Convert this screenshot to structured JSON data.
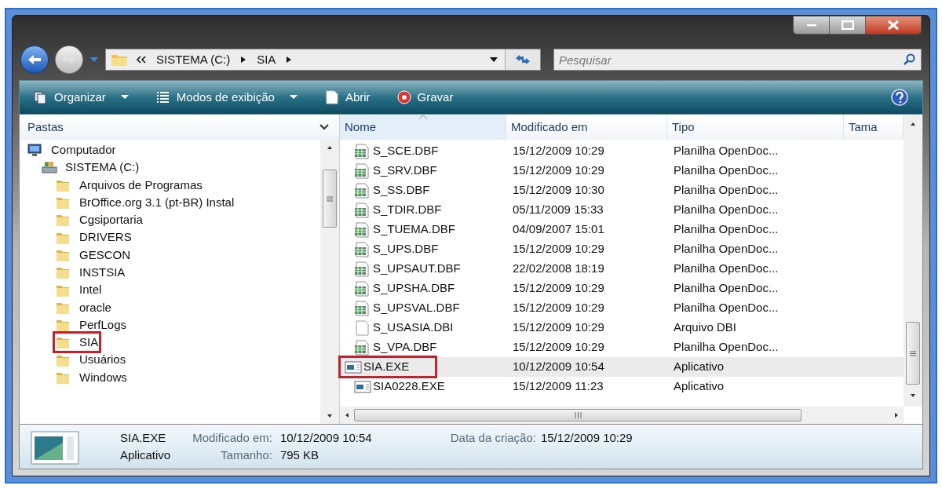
{
  "address": {
    "segments": [
      "SISTEMA (C:)",
      "SIA"
    ]
  },
  "search": {
    "placeholder": "Pesquisar"
  },
  "toolbar": [
    {
      "label": "Organizar",
      "kind": "organize",
      "dropdown": true
    },
    {
      "label": "Modos de exibição",
      "kind": "views",
      "dropdown": true
    },
    {
      "label": "Abrir",
      "kind": "open",
      "dropdown": false
    },
    {
      "label": "Gravar",
      "kind": "burn",
      "dropdown": false
    }
  ],
  "folders_pane": {
    "title": "Pastas",
    "tree": [
      {
        "label": "Computador",
        "kind": "computer",
        "highlighted": false,
        "children": [
          {
            "label": "SISTEMA (C:)",
            "kind": "drive",
            "highlighted": false,
            "children": [
              {
                "label": "Arquivos de Programas",
                "kind": "folder",
                "highlighted": false
              },
              {
                "label": "BrOffice.org 3.1 (pt-BR) Instal",
                "kind": "folder",
                "highlighted": false
              },
              {
                "label": "Cgsiportaria",
                "kind": "folder",
                "highlighted": false
              },
              {
                "label": "DRIVERS",
                "kind": "folder",
                "highlighted": false
              },
              {
                "label": "GESCON",
                "kind": "folder",
                "highlighted": false
              },
              {
                "label": "INSTSIA",
                "kind": "folder",
                "highlighted": false
              },
              {
                "label": "Intel",
                "kind": "folder",
                "highlighted": false
              },
              {
                "label": "oracle",
                "kind": "folder",
                "highlighted": false
              },
              {
                "label": "PerfLogs",
                "kind": "folder",
                "highlighted": false
              },
              {
                "label": "SIA",
                "kind": "folder",
                "highlighted": true
              },
              {
                "label": "Usuários",
                "kind": "folder",
                "highlighted": false
              },
              {
                "label": "Windows",
                "kind": "folder",
                "highlighted": false
              }
            ]
          }
        ]
      }
    ]
  },
  "file_list": {
    "columns": [
      "Nome",
      "Modificado em",
      "Tipo",
      "Tama"
    ],
    "rows": [
      {
        "name": "S_SCE.DBF",
        "modified": "15/12/2009 10:29",
        "type": "Planilha OpenDoc...",
        "kind": "spreadsheet",
        "selected": false,
        "highlighted": false
      },
      {
        "name": "S_SRV.DBF",
        "modified": "15/12/2009 10:29",
        "type": "Planilha OpenDoc...",
        "kind": "spreadsheet",
        "selected": false,
        "highlighted": false
      },
      {
        "name": "S_SS.DBF",
        "modified": "15/12/2009 10:30",
        "type": "Planilha OpenDoc...",
        "kind": "spreadsheet",
        "selected": false,
        "highlighted": false
      },
      {
        "name": "S_TDIR.DBF",
        "modified": "05/11/2009 15:33",
        "type": "Planilha OpenDoc...",
        "kind": "spreadsheet",
        "selected": false,
        "highlighted": false
      },
      {
        "name": "S_TUEMA.DBF",
        "modified": "04/09/2007 15:01",
        "type": "Planilha OpenDoc...",
        "kind": "spreadsheet",
        "selected": false,
        "highlighted": false
      },
      {
        "name": "S_UPS.DBF",
        "modified": "15/12/2009 10:29",
        "type": "Planilha OpenDoc...",
        "kind": "spreadsheet",
        "selected": false,
        "highlighted": false
      },
      {
        "name": "S_UPSAUT.DBF",
        "modified": "22/02/2008 18:19",
        "type": "Planilha OpenDoc...",
        "kind": "spreadsheet",
        "selected": false,
        "highlighted": false
      },
      {
        "name": "S_UPSHA.DBF",
        "modified": "15/12/2009 10:29",
        "type": "Planilha OpenDoc...",
        "kind": "spreadsheet",
        "selected": false,
        "highlighted": false
      },
      {
        "name": "S_UPSVAL.DBF",
        "modified": "15/12/2009 10:29",
        "type": "Planilha OpenDoc...",
        "kind": "spreadsheet",
        "selected": false,
        "highlighted": false
      },
      {
        "name": "S_USASIA.DBI",
        "modified": "15/12/2009 10:29",
        "type": "Arquivo DBI",
        "kind": "document",
        "selected": false,
        "highlighted": false
      },
      {
        "name": "S_VPA.DBF",
        "modified": "15/12/2009 10:29",
        "type": "Planilha OpenDoc...",
        "kind": "spreadsheet",
        "selected": false,
        "highlighted": false
      },
      {
        "name": "SIA.EXE",
        "modified": "10/12/2009 10:54",
        "type": "Aplicativo",
        "kind": "application",
        "selected": true,
        "highlighted": true
      },
      {
        "name": "SIA0228.EXE",
        "modified": "15/12/2009 11:23",
        "type": "Aplicativo",
        "kind": "application",
        "selected": false,
        "highlighted": false
      }
    ]
  },
  "details": {
    "name": "SIA.EXE",
    "type": "Aplicativo",
    "fields": [
      {
        "label": "Modificado em:",
        "value": "10/12/2009 10:54"
      },
      {
        "label": "Tamanho:",
        "value": "795 KB"
      },
      {
        "label": "Data da criação:",
        "value": "15/12/2009 10:29"
      }
    ]
  }
}
